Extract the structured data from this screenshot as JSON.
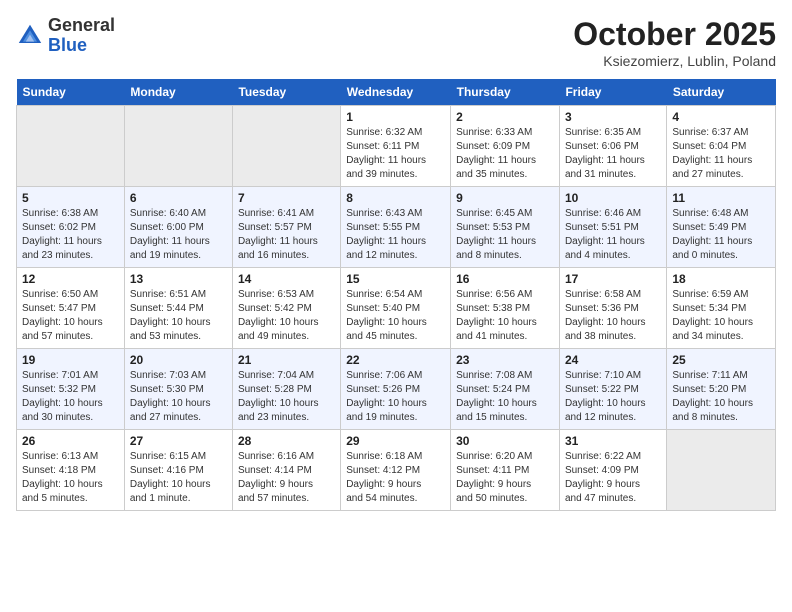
{
  "header": {
    "logo_general": "General",
    "logo_blue": "Blue",
    "month_title": "October 2025",
    "subtitle": "Ksiezomierz, Lublin, Poland"
  },
  "days_of_week": [
    "Sunday",
    "Monday",
    "Tuesday",
    "Wednesday",
    "Thursday",
    "Friday",
    "Saturday"
  ],
  "weeks": [
    [
      {
        "day": "",
        "info": ""
      },
      {
        "day": "",
        "info": ""
      },
      {
        "day": "",
        "info": ""
      },
      {
        "day": "1",
        "info": "Sunrise: 6:32 AM\nSunset: 6:11 PM\nDaylight: 11 hours\nand 39 minutes."
      },
      {
        "day": "2",
        "info": "Sunrise: 6:33 AM\nSunset: 6:09 PM\nDaylight: 11 hours\nand 35 minutes."
      },
      {
        "day": "3",
        "info": "Sunrise: 6:35 AM\nSunset: 6:06 PM\nDaylight: 11 hours\nand 31 minutes."
      },
      {
        "day": "4",
        "info": "Sunrise: 6:37 AM\nSunset: 6:04 PM\nDaylight: 11 hours\nand 27 minutes."
      }
    ],
    [
      {
        "day": "5",
        "info": "Sunrise: 6:38 AM\nSunset: 6:02 PM\nDaylight: 11 hours\nand 23 minutes."
      },
      {
        "day": "6",
        "info": "Sunrise: 6:40 AM\nSunset: 6:00 PM\nDaylight: 11 hours\nand 19 minutes."
      },
      {
        "day": "7",
        "info": "Sunrise: 6:41 AM\nSunset: 5:57 PM\nDaylight: 11 hours\nand 16 minutes."
      },
      {
        "day": "8",
        "info": "Sunrise: 6:43 AM\nSunset: 5:55 PM\nDaylight: 11 hours\nand 12 minutes."
      },
      {
        "day": "9",
        "info": "Sunrise: 6:45 AM\nSunset: 5:53 PM\nDaylight: 11 hours\nand 8 minutes."
      },
      {
        "day": "10",
        "info": "Sunrise: 6:46 AM\nSunset: 5:51 PM\nDaylight: 11 hours\nand 4 minutes."
      },
      {
        "day": "11",
        "info": "Sunrise: 6:48 AM\nSunset: 5:49 PM\nDaylight: 11 hours\nand 0 minutes."
      }
    ],
    [
      {
        "day": "12",
        "info": "Sunrise: 6:50 AM\nSunset: 5:47 PM\nDaylight: 10 hours\nand 57 minutes."
      },
      {
        "day": "13",
        "info": "Sunrise: 6:51 AM\nSunset: 5:44 PM\nDaylight: 10 hours\nand 53 minutes."
      },
      {
        "day": "14",
        "info": "Sunrise: 6:53 AM\nSunset: 5:42 PM\nDaylight: 10 hours\nand 49 minutes."
      },
      {
        "day": "15",
        "info": "Sunrise: 6:54 AM\nSunset: 5:40 PM\nDaylight: 10 hours\nand 45 minutes."
      },
      {
        "day": "16",
        "info": "Sunrise: 6:56 AM\nSunset: 5:38 PM\nDaylight: 10 hours\nand 41 minutes."
      },
      {
        "day": "17",
        "info": "Sunrise: 6:58 AM\nSunset: 5:36 PM\nDaylight: 10 hours\nand 38 minutes."
      },
      {
        "day": "18",
        "info": "Sunrise: 6:59 AM\nSunset: 5:34 PM\nDaylight: 10 hours\nand 34 minutes."
      }
    ],
    [
      {
        "day": "19",
        "info": "Sunrise: 7:01 AM\nSunset: 5:32 PM\nDaylight: 10 hours\nand 30 minutes."
      },
      {
        "day": "20",
        "info": "Sunrise: 7:03 AM\nSunset: 5:30 PM\nDaylight: 10 hours\nand 27 minutes."
      },
      {
        "day": "21",
        "info": "Sunrise: 7:04 AM\nSunset: 5:28 PM\nDaylight: 10 hours\nand 23 minutes."
      },
      {
        "day": "22",
        "info": "Sunrise: 7:06 AM\nSunset: 5:26 PM\nDaylight: 10 hours\nand 19 minutes."
      },
      {
        "day": "23",
        "info": "Sunrise: 7:08 AM\nSunset: 5:24 PM\nDaylight: 10 hours\nand 15 minutes."
      },
      {
        "day": "24",
        "info": "Sunrise: 7:10 AM\nSunset: 5:22 PM\nDaylight: 10 hours\nand 12 minutes."
      },
      {
        "day": "25",
        "info": "Sunrise: 7:11 AM\nSunset: 5:20 PM\nDaylight: 10 hours\nand 8 minutes."
      }
    ],
    [
      {
        "day": "26",
        "info": "Sunrise: 6:13 AM\nSunset: 4:18 PM\nDaylight: 10 hours\nand 5 minutes."
      },
      {
        "day": "27",
        "info": "Sunrise: 6:15 AM\nSunset: 4:16 PM\nDaylight: 10 hours\nand 1 minute."
      },
      {
        "day": "28",
        "info": "Sunrise: 6:16 AM\nSunset: 4:14 PM\nDaylight: 9 hours\nand 57 minutes."
      },
      {
        "day": "29",
        "info": "Sunrise: 6:18 AM\nSunset: 4:12 PM\nDaylight: 9 hours\nand 54 minutes."
      },
      {
        "day": "30",
        "info": "Sunrise: 6:20 AM\nSunset: 4:11 PM\nDaylight: 9 hours\nand 50 minutes."
      },
      {
        "day": "31",
        "info": "Sunrise: 6:22 AM\nSunset: 4:09 PM\nDaylight: 9 hours\nand 47 minutes."
      },
      {
        "day": "",
        "info": ""
      }
    ]
  ]
}
